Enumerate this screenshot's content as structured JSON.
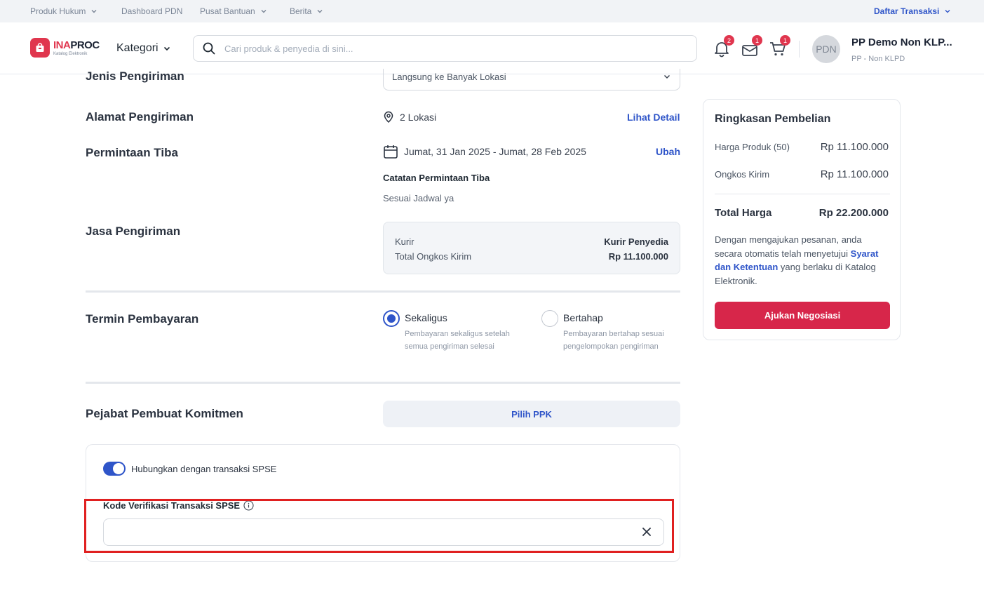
{
  "topnav": {
    "items": [
      {
        "label": "Produk Hukum",
        "has_dropdown": true
      },
      {
        "label": "Dashboard PDN",
        "has_dropdown": false
      },
      {
        "label": "Pusat Bantuan",
        "has_dropdown": true
      },
      {
        "label": "Berita",
        "has_dropdown": true
      }
    ],
    "right_link": "Daftar Transaksi"
  },
  "header": {
    "logo_name_accent": "INA",
    "logo_name_rest": "PROC",
    "logo_sub": "Katalog Elektronik",
    "kategori_label": "Kategori",
    "search_placeholder": "Cari produk & penyedia di sini...",
    "notifications_count": "2",
    "messages_count": "1",
    "cart_count": "1",
    "avatar_initials": "PDN",
    "user_name": "PP Demo Non KLP...",
    "user_role": "PP - Non KLPD"
  },
  "form": {
    "jenis_pengiriman_label": "Jenis Pengiriman",
    "jenis_pengiriman_value": "Langsung ke Banyak Lokasi",
    "alamat_label": "Alamat Pengiriman",
    "alamat_value": "2 Lokasi",
    "alamat_link": "Lihat Detail",
    "permintaan_label": "Permintaan Tiba",
    "permintaan_value": "Jumat, 31 Jan 2025 - Jumat, 28 Feb 2025",
    "permintaan_link": "Ubah",
    "catatan_label": "Catatan Permintaan Tiba",
    "catatan_value": "Sesuai Jadwal ya",
    "jasa_label": "Jasa Pengiriman",
    "kurir_label": "Kurir",
    "kurir_value": "Kurir Penyedia",
    "ongkos_label": "Total Ongkos Kirim",
    "ongkos_value": "Rp 11.100.000",
    "termin_label": "Termin Pembayaran",
    "termin_options": [
      {
        "title": "Sekaligus",
        "desc": "Pembayaran sekaligus setelah semua pengiriman selesai",
        "selected": true
      },
      {
        "title": "Bertahap",
        "desc": "Pembayaran bertahap sesuai pengelompokan pengiriman",
        "selected": false
      }
    ],
    "ppk_label": "Pejabat Pembuat Komitmen",
    "ppk_button": "Pilih PPK",
    "spse_toggle_label": "Hubungkan dengan transaksi SPSE",
    "spse_toggle_on": true,
    "spse_code_label": "Kode Verifikasi Transaksi SPSE",
    "spse_code_value": ""
  },
  "summary": {
    "title": "Ringkasan Pembelian",
    "harga_produk_label": "Harga Produk (50)",
    "harga_produk_value": "Rp 11.100.000",
    "ongkos_label": "Ongkos Kirim",
    "ongkos_value": "Rp 11.100.000",
    "total_label": "Total Harga",
    "total_value": "Rp 22.200.000",
    "terms_before": "Dengan mengajukan pesanan, anda secara otomatis telah menyetujui ",
    "terms_link": "Syarat dan Ketentuan",
    "terms_after": " yang berlaku di Katalog Elektronik.",
    "cta": "Ajukan Negosiasi"
  },
  "colors": {
    "accent_blue": "#2f55c9",
    "brand_red": "#d7264a",
    "highlight_red": "#e02020"
  }
}
